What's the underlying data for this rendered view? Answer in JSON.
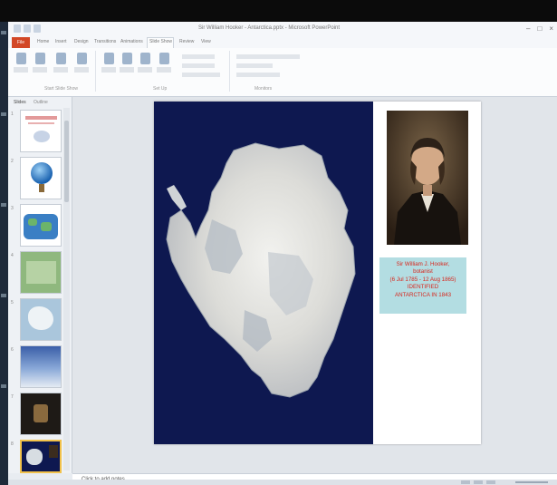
{
  "window": {
    "title": "Sir William Hooker - Antarctica.pptx - Microsoft PowerPoint",
    "controls": [
      "–",
      "□",
      "×"
    ]
  },
  "ribbon": {
    "file_tab": "File",
    "tabs": [
      "Home",
      "Insert",
      "Design",
      "Transitions",
      "Animations",
      "Slide Show",
      "Review",
      "View"
    ],
    "active_tab": "Slide Show",
    "groups": [
      "Start Slide Show",
      "Set Up",
      "Monitors"
    ]
  },
  "slides_panel": {
    "tabs": [
      "Slides",
      "Outline"
    ],
    "thumbnail_numbers": [
      "1",
      "2",
      "3",
      "4",
      "5",
      "6",
      "7",
      "8"
    ],
    "selected_index": 8
  },
  "slide": {
    "image_subject": "Satellite image of Antarctica",
    "portrait_subject": "Portrait of Sir William J. Hooker",
    "caption_lines": [
      "Sir William J. Hooker,",
      "botanist",
      "(6 Jul 1785 - 12 Aug 1865)",
      "IDENTIFIED",
      "ANTARCTICA IN 1843"
    ]
  },
  "notes": {
    "placeholder": "Click to add notes"
  },
  "colors": {
    "accent_file": "#d24726",
    "ocean": "#0e1850",
    "caption_bg": "#b3dde2",
    "caption_text": "#d8261c"
  }
}
